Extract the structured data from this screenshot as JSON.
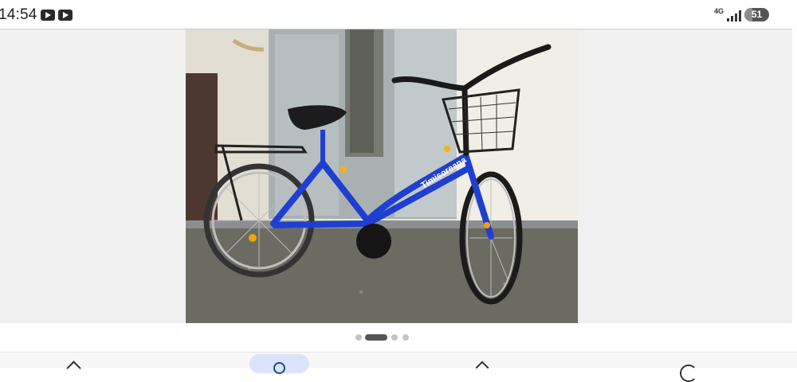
{
  "status": {
    "time": "14:54",
    "network": "4G",
    "battery": "51",
    "notification_icons": [
      "youtube-icon",
      "youtube-icon"
    ]
  },
  "gallery": {
    "image_count": 4,
    "active_index": 1
  },
  "bottom_nav": {
    "icons": [
      "home-icon",
      "search-icon",
      "saved-icon",
      "account-icon"
    ],
    "active": "search-icon"
  },
  "colors": {
    "bike_frame": "#1f3fd0",
    "nav_active": "#dbe4fb"
  }
}
